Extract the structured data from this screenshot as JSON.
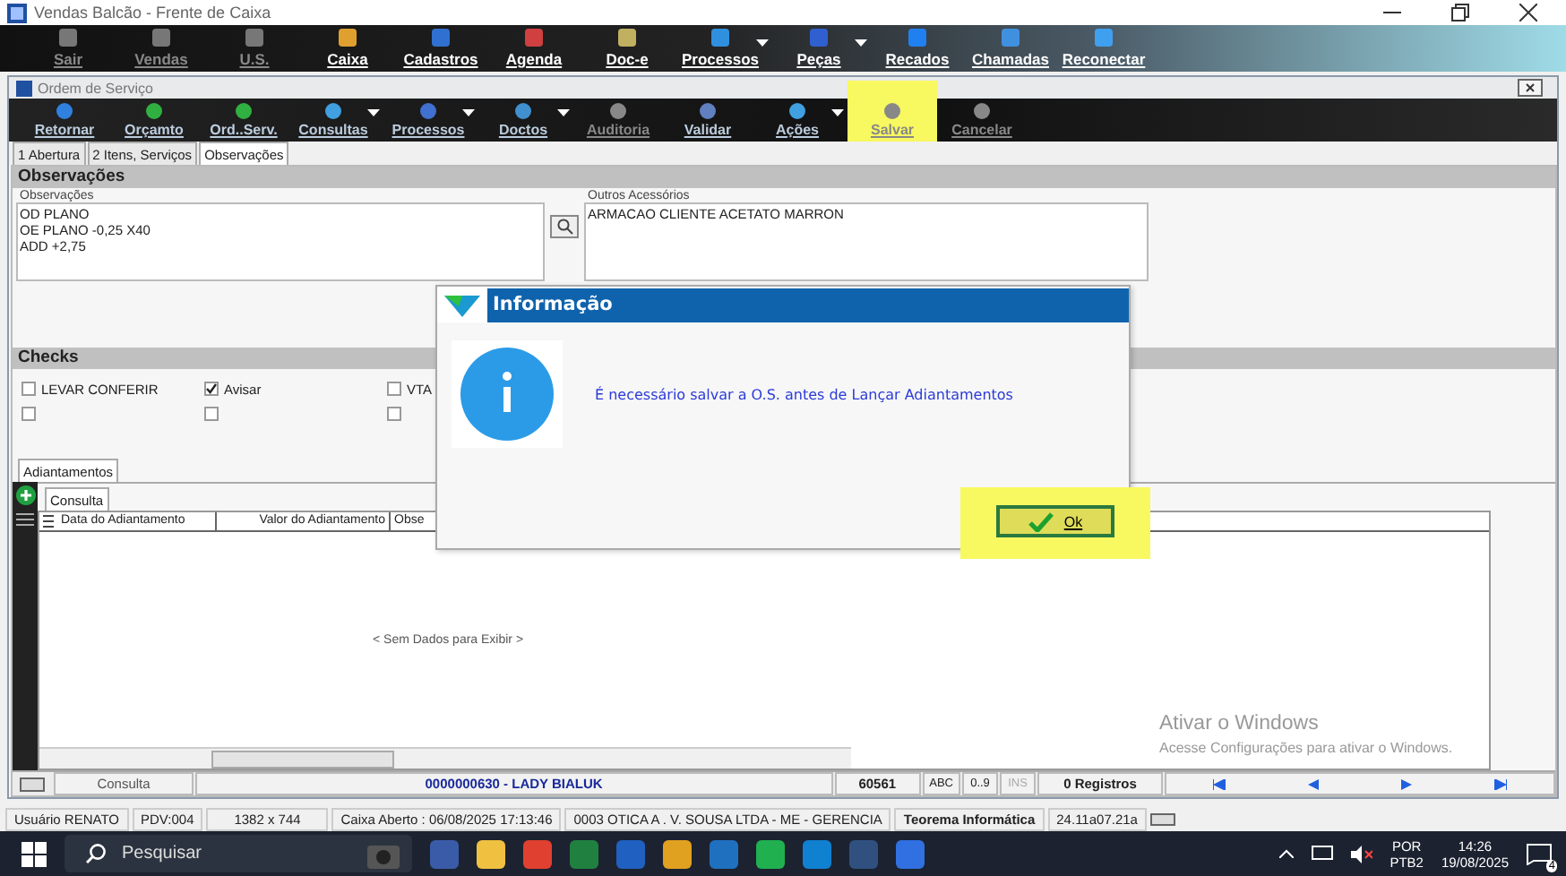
{
  "window": {
    "title": "Vendas Balcão - Frente de Caixa"
  },
  "main_toolbar": [
    {
      "label": "Sair",
      "disabled": true,
      "has_menu": false
    },
    {
      "label": "Vendas",
      "disabled": true,
      "has_menu": false
    },
    {
      "label": "U.S.",
      "disabled": true,
      "has_menu": false
    },
    {
      "label": "Caixa",
      "disabled": false,
      "has_menu": false
    },
    {
      "label": "Cadastros",
      "disabled": false,
      "has_menu": false
    },
    {
      "label": "Agenda",
      "disabled": false,
      "has_menu": false
    },
    {
      "label": "Doc-e",
      "disabled": false,
      "has_menu": false
    },
    {
      "label": "Processos",
      "disabled": false,
      "has_menu": true
    },
    {
      "label": "Peças",
      "disabled": false,
      "has_menu": true
    },
    {
      "label": "Recados",
      "disabled": false,
      "has_menu": false
    },
    {
      "label": "Chamadas",
      "disabled": false,
      "has_menu": false
    },
    {
      "label": "Reconectar",
      "disabled": false,
      "has_menu": false
    }
  ],
  "child_window": {
    "title": "Ordem de Serviço"
  },
  "child_toolbar": [
    {
      "label": "Retornar",
      "disabled": false,
      "has_menu": false,
      "highlighted": false
    },
    {
      "label": "Orçamto",
      "disabled": false,
      "has_menu": false,
      "highlighted": false
    },
    {
      "label": "Ord..Serv.",
      "disabled": false,
      "has_menu": false,
      "highlighted": false
    },
    {
      "label": "Consultas",
      "disabled": false,
      "has_menu": true,
      "highlighted": false
    },
    {
      "label": "Processos",
      "disabled": false,
      "has_menu": true,
      "highlighted": false
    },
    {
      "label": "Doctos",
      "disabled": false,
      "has_menu": true,
      "highlighted": false
    },
    {
      "label": "Auditoria",
      "disabled": true,
      "has_menu": false,
      "highlighted": false
    },
    {
      "label": "Validar",
      "disabled": false,
      "has_menu": false,
      "highlighted": false
    },
    {
      "label": "Ações",
      "disabled": false,
      "has_menu": true,
      "highlighted": false
    },
    {
      "label": "Salvar",
      "disabled": true,
      "has_menu": false,
      "highlighted": true
    },
    {
      "label": "Cancelar",
      "disabled": true,
      "has_menu": false,
      "highlighted": false
    }
  ],
  "tabs": [
    {
      "label": "1 Abertura",
      "selected": false
    },
    {
      "label": "2 Itens, Serviços",
      "selected": false
    },
    {
      "label": "Observações",
      "selected": true
    }
  ],
  "observacoes": {
    "header": "Observações",
    "field_label": "Observações",
    "lines": [
      "OD PLANO",
      "OE PLANO -0,25 X40",
      "ADD +2,75"
    ],
    "accessories_label": "Outros Acessórios",
    "accessories": "ARMACAO CLIENTE ACETATO MARRON"
  },
  "checks": {
    "header": "Checks",
    "items": [
      {
        "label": "LEVAR CONFERIR",
        "checked": false
      },
      {
        "label": "Avisar",
        "checked": true
      },
      {
        "label": "VTA",
        "checked": false
      },
      {
        "checked": false
      },
      {
        "checked": false
      },
      {
        "checked": false
      }
    ]
  },
  "adiantamentos": {
    "tab": "Adiantamentos",
    "subtab": "Consulta",
    "columns": [
      "Data do Adiantamento",
      "Valor do Adiantamento",
      "Obse"
    ],
    "empty": "< Sem Dados para Exibir >"
  },
  "dialog": {
    "title": "Informação",
    "message": "É necessário salvar a O.S. antes de Lançar Adiantamentos",
    "button": "Ok",
    "button_highlighted": true
  },
  "status_bar": {
    "mode": "Consulta",
    "record": "0000000630 - LADY BIALUK",
    "code": "60561",
    "abc": "ABC",
    "digits": "0..9",
    "ins": "INS",
    "count": "0 Registros"
  },
  "info_bar": [
    "Usuário RENATO",
    "PDV:004",
    "1382 x 744",
    "Caixa Aberto : 06/08/2025 17:13:46",
    "0003 OTICA A . V. SOUSA LTDA - ME - GERENCIA",
    "Teorema Informática",
    "24.11a07.21a"
  ],
  "activation": {
    "title": "Ativar o Windows",
    "text": "Acesse Configurações para ativar o Windows."
  },
  "taskbar": {
    "search": "Pesquisar",
    "lang": "POR",
    "layout": "PTB2",
    "time": "14:26",
    "date": "19/08/2025",
    "notifications": "4"
  }
}
